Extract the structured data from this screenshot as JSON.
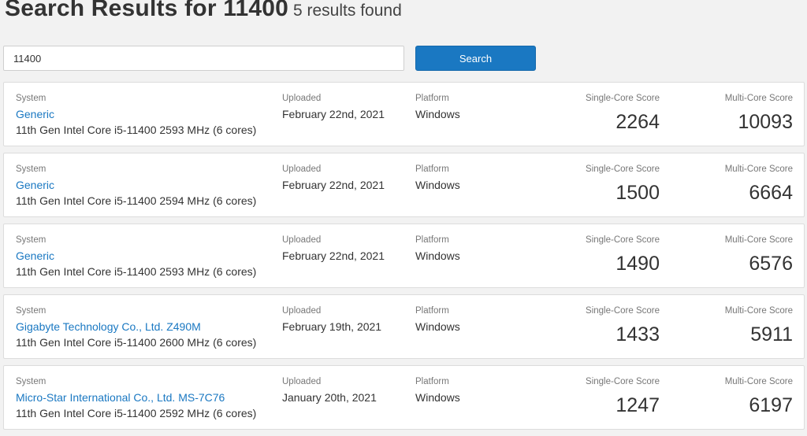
{
  "header": {
    "title": "Search Results for 11400",
    "subtitle": "5 results found"
  },
  "search": {
    "value": "11400",
    "button_label": "Search"
  },
  "labels": {
    "system": "System",
    "uploaded": "Uploaded",
    "platform": "Platform",
    "single_core": "Single-Core Score",
    "multi_core": "Multi-Core Score"
  },
  "results": [
    {
      "system_name": "Generic",
      "cpu": "11th Gen Intel Core i5-11400 2593 MHz (6 cores)",
      "uploaded": "February 22nd, 2021",
      "platform": "Windows",
      "single_core": "2264",
      "multi_core": "10093"
    },
    {
      "system_name": "Generic",
      "cpu": "11th Gen Intel Core i5-11400 2594 MHz (6 cores)",
      "uploaded": "February 22nd, 2021",
      "platform": "Windows",
      "single_core": "1500",
      "multi_core": "6664"
    },
    {
      "system_name": "Generic",
      "cpu": "11th Gen Intel Core i5-11400 2593 MHz (6 cores)",
      "uploaded": "February 22nd, 2021",
      "platform": "Windows",
      "single_core": "1490",
      "multi_core": "6576"
    },
    {
      "system_name": "Gigabyte Technology Co., Ltd. Z490M",
      "cpu": "11th Gen Intel Core i5-11400 2600 MHz (6 cores)",
      "uploaded": "February 19th, 2021",
      "platform": "Windows",
      "single_core": "1433",
      "multi_core": "5911"
    },
    {
      "system_name": "Micro-Star International Co., Ltd. MS-7C76",
      "cpu": "11th Gen Intel Core i5-11400 2592 MHz (6 cores)",
      "uploaded": "January 20th, 2021",
      "platform": "Windows",
      "single_core": "1247",
      "multi_core": "6197"
    }
  ]
}
